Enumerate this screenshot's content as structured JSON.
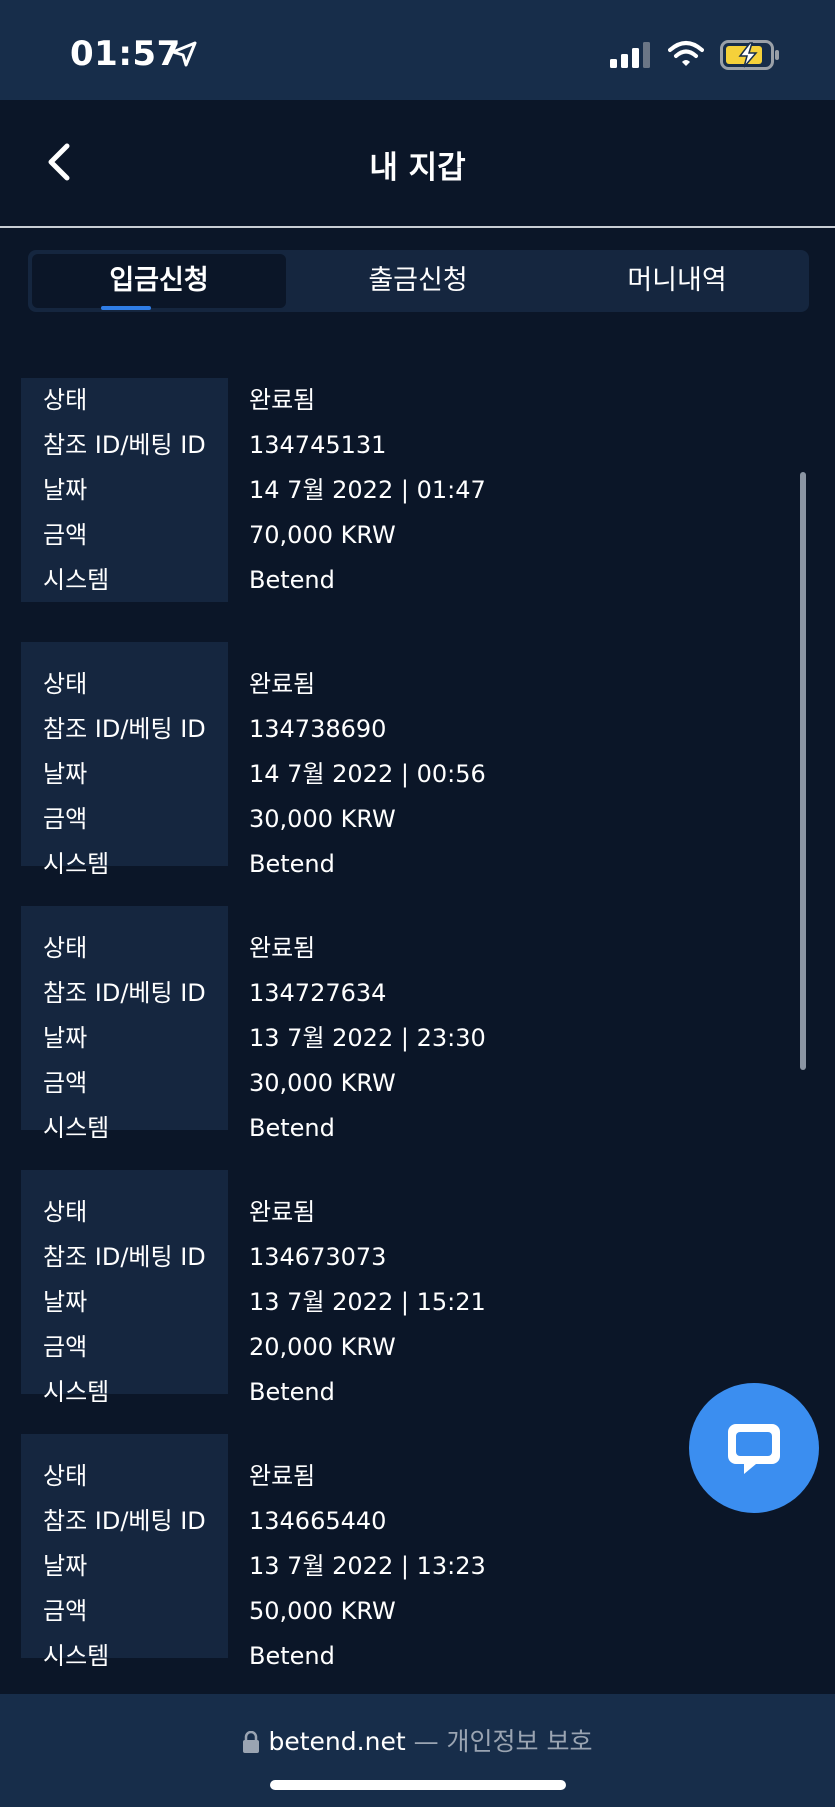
{
  "status_bar": {
    "time": "01:57"
  },
  "header": {
    "title": "내 지갑"
  },
  "tabs": [
    {
      "label": "입금신청",
      "active": true
    },
    {
      "label": "출금신청",
      "active": false
    },
    {
      "label": "머니내역",
      "active": false
    }
  ],
  "labels": {
    "status": "상태",
    "ref_id": "참조 ID/베팅 ID",
    "date": "날짜",
    "amount": "금액",
    "system": "시스템"
  },
  "transactions": [
    {
      "status": "완료됨",
      "ref_id": "134745131",
      "date": "14 7월 2022 | 01:47",
      "amount": "70,000 KRW",
      "system": "Betend"
    },
    {
      "status": "완료됨",
      "ref_id": "134738690",
      "date": "14 7월 2022 | 00:56",
      "amount": "30,000 KRW",
      "system": "Betend"
    },
    {
      "status": "완료됨",
      "ref_id": "134727634",
      "date": "13 7월 2022 | 23:30",
      "amount": "30,000 KRW",
      "system": "Betend"
    },
    {
      "status": "완료됨",
      "ref_id": "134673073",
      "date": "13 7월 2022 | 15:21",
      "amount": "20,000 KRW",
      "system": "Betend"
    },
    {
      "status": "완료됨",
      "ref_id": "134665440",
      "date": "13 7월 2022 | 13:23",
      "amount": "50,000 KRW",
      "system": "Betend"
    }
  ],
  "footer": {
    "domain": "betend.net",
    "privacy": "— 개인정보 보호"
  },
  "colors": {
    "accent": "#2f7de6",
    "chat": "#3b8ef0",
    "background": "#0b1628",
    "panel": "#15263f"
  }
}
